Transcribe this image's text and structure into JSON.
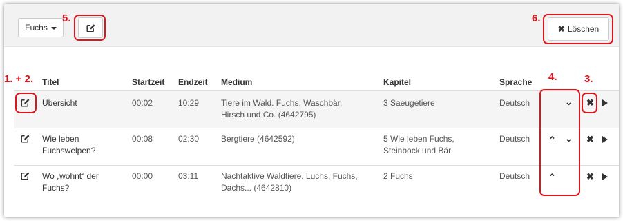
{
  "toolbar": {
    "dropdown_label": "Fuchs",
    "delete_label": "Löschen",
    "edit_icon": "edit-icon",
    "delete_icon": "close-icon"
  },
  "annotations": {
    "n1": "1. + 2.",
    "n3": "3.",
    "n4": "4.",
    "n5": "5.",
    "n6": "6.",
    "color": "#e0151b"
  },
  "table": {
    "columns": [
      "Titel",
      "Startzeit",
      "Endzeit",
      "Medium",
      "Kapitel",
      "Sprache"
    ],
    "rows": [
      {
        "titel": "Übersicht",
        "startzeit": "00:02",
        "endzeit": "10:29",
        "medium_l1": "Tiere im Wald. Fuchs, Waschbär,",
        "medium_l2": "Hirsch und Co. (4642795)",
        "kapitel_l1": "3 Saeugetiere",
        "kapitel_l2": "",
        "sprache": "Deutsch"
      },
      {
        "titel_l1": "Wie leben",
        "titel_l2": "Fuchswelpen?",
        "startzeit": "00:08",
        "endzeit": "02:30",
        "medium_l1": "Bergtiere (4642592)",
        "medium_l2": "",
        "kapitel_l1": "5 Wie leben Fuchs,",
        "kapitel_l2": "Steinbock und Bär",
        "sprache": "Deutsch"
      },
      {
        "titel_l1": "Wo „wohnt“ der",
        "titel_l2": "Fuchs?",
        "startzeit": "00:00",
        "endzeit": "03:11",
        "medium_l1": "Nachtaktive Waldtiere. Luchs, Fuchs,",
        "medium_l2": "Dachs... (4642810)",
        "kapitel_l1": "2 Fuchs",
        "kapitel_l2": "",
        "sprache": "Deutsch"
      }
    ]
  }
}
